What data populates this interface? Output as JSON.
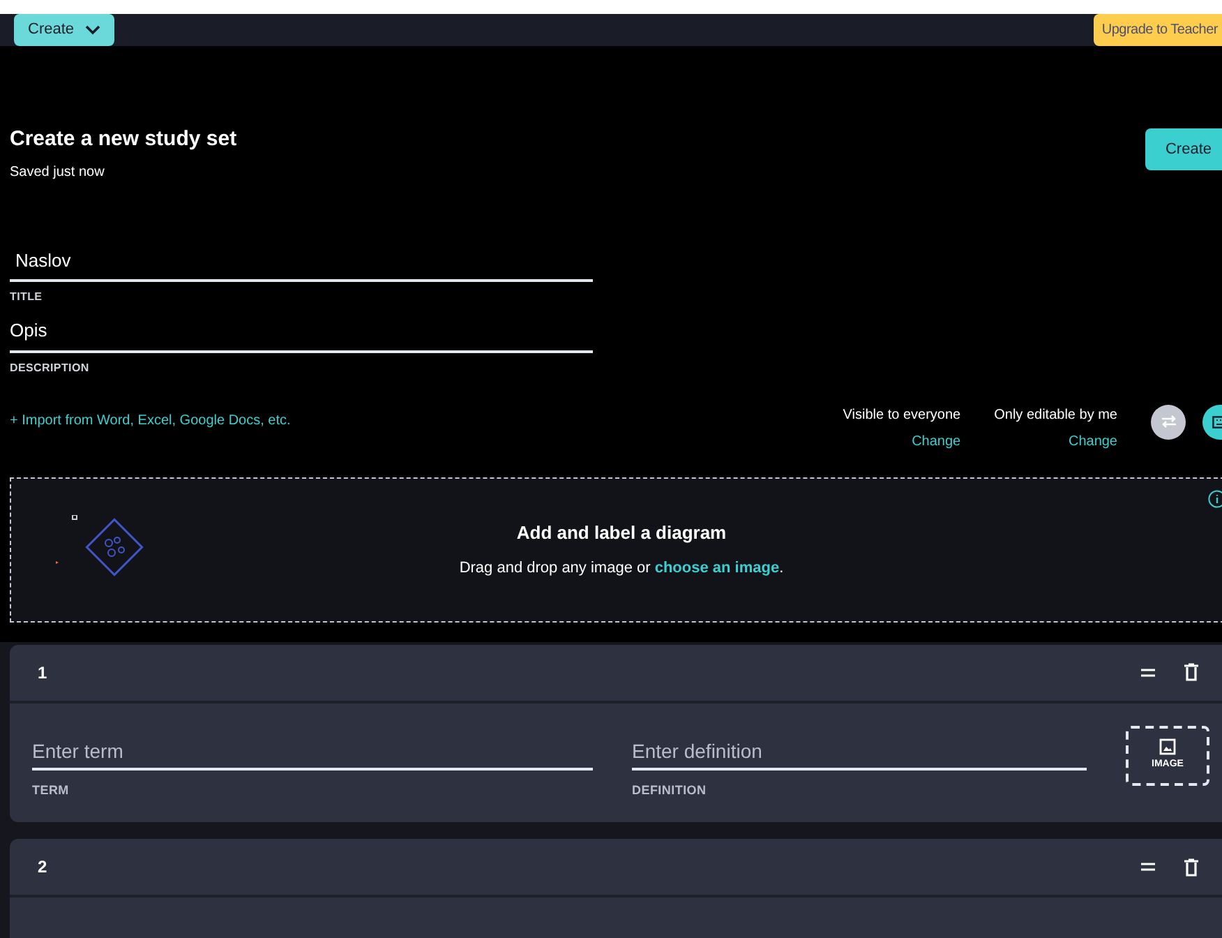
{
  "topbar": {
    "create_menu": "Create",
    "upgrade": "Upgrade to Teacher"
  },
  "header": {
    "title": "Create a new study set",
    "status": "Saved just now",
    "create_button": "Create"
  },
  "title_field": {
    "value": "Naslov",
    "label": "TITLE"
  },
  "description_field": {
    "value": "Opis",
    "label": "DESCRIPTION"
  },
  "import_link": "+ Import from Word, Excel, Google Docs, etc.",
  "visibility": [
    {
      "label": "Visible to everyone",
      "action": "Change"
    },
    {
      "label": "Only editable by me",
      "action": "Change"
    }
  ],
  "diagram": {
    "title": "Add and label a diagram",
    "text": "Drag and drop any image or ",
    "link": "choose an image",
    "end": "."
  },
  "cards": [
    {
      "number": "1",
      "term_placeholder": "Enter term",
      "term_label": "TERM",
      "definition_placeholder": "Enter definition",
      "definition_label": "DEFINITION",
      "image_label": "IMAGE"
    },
    {
      "number": "2"
    }
  ]
}
